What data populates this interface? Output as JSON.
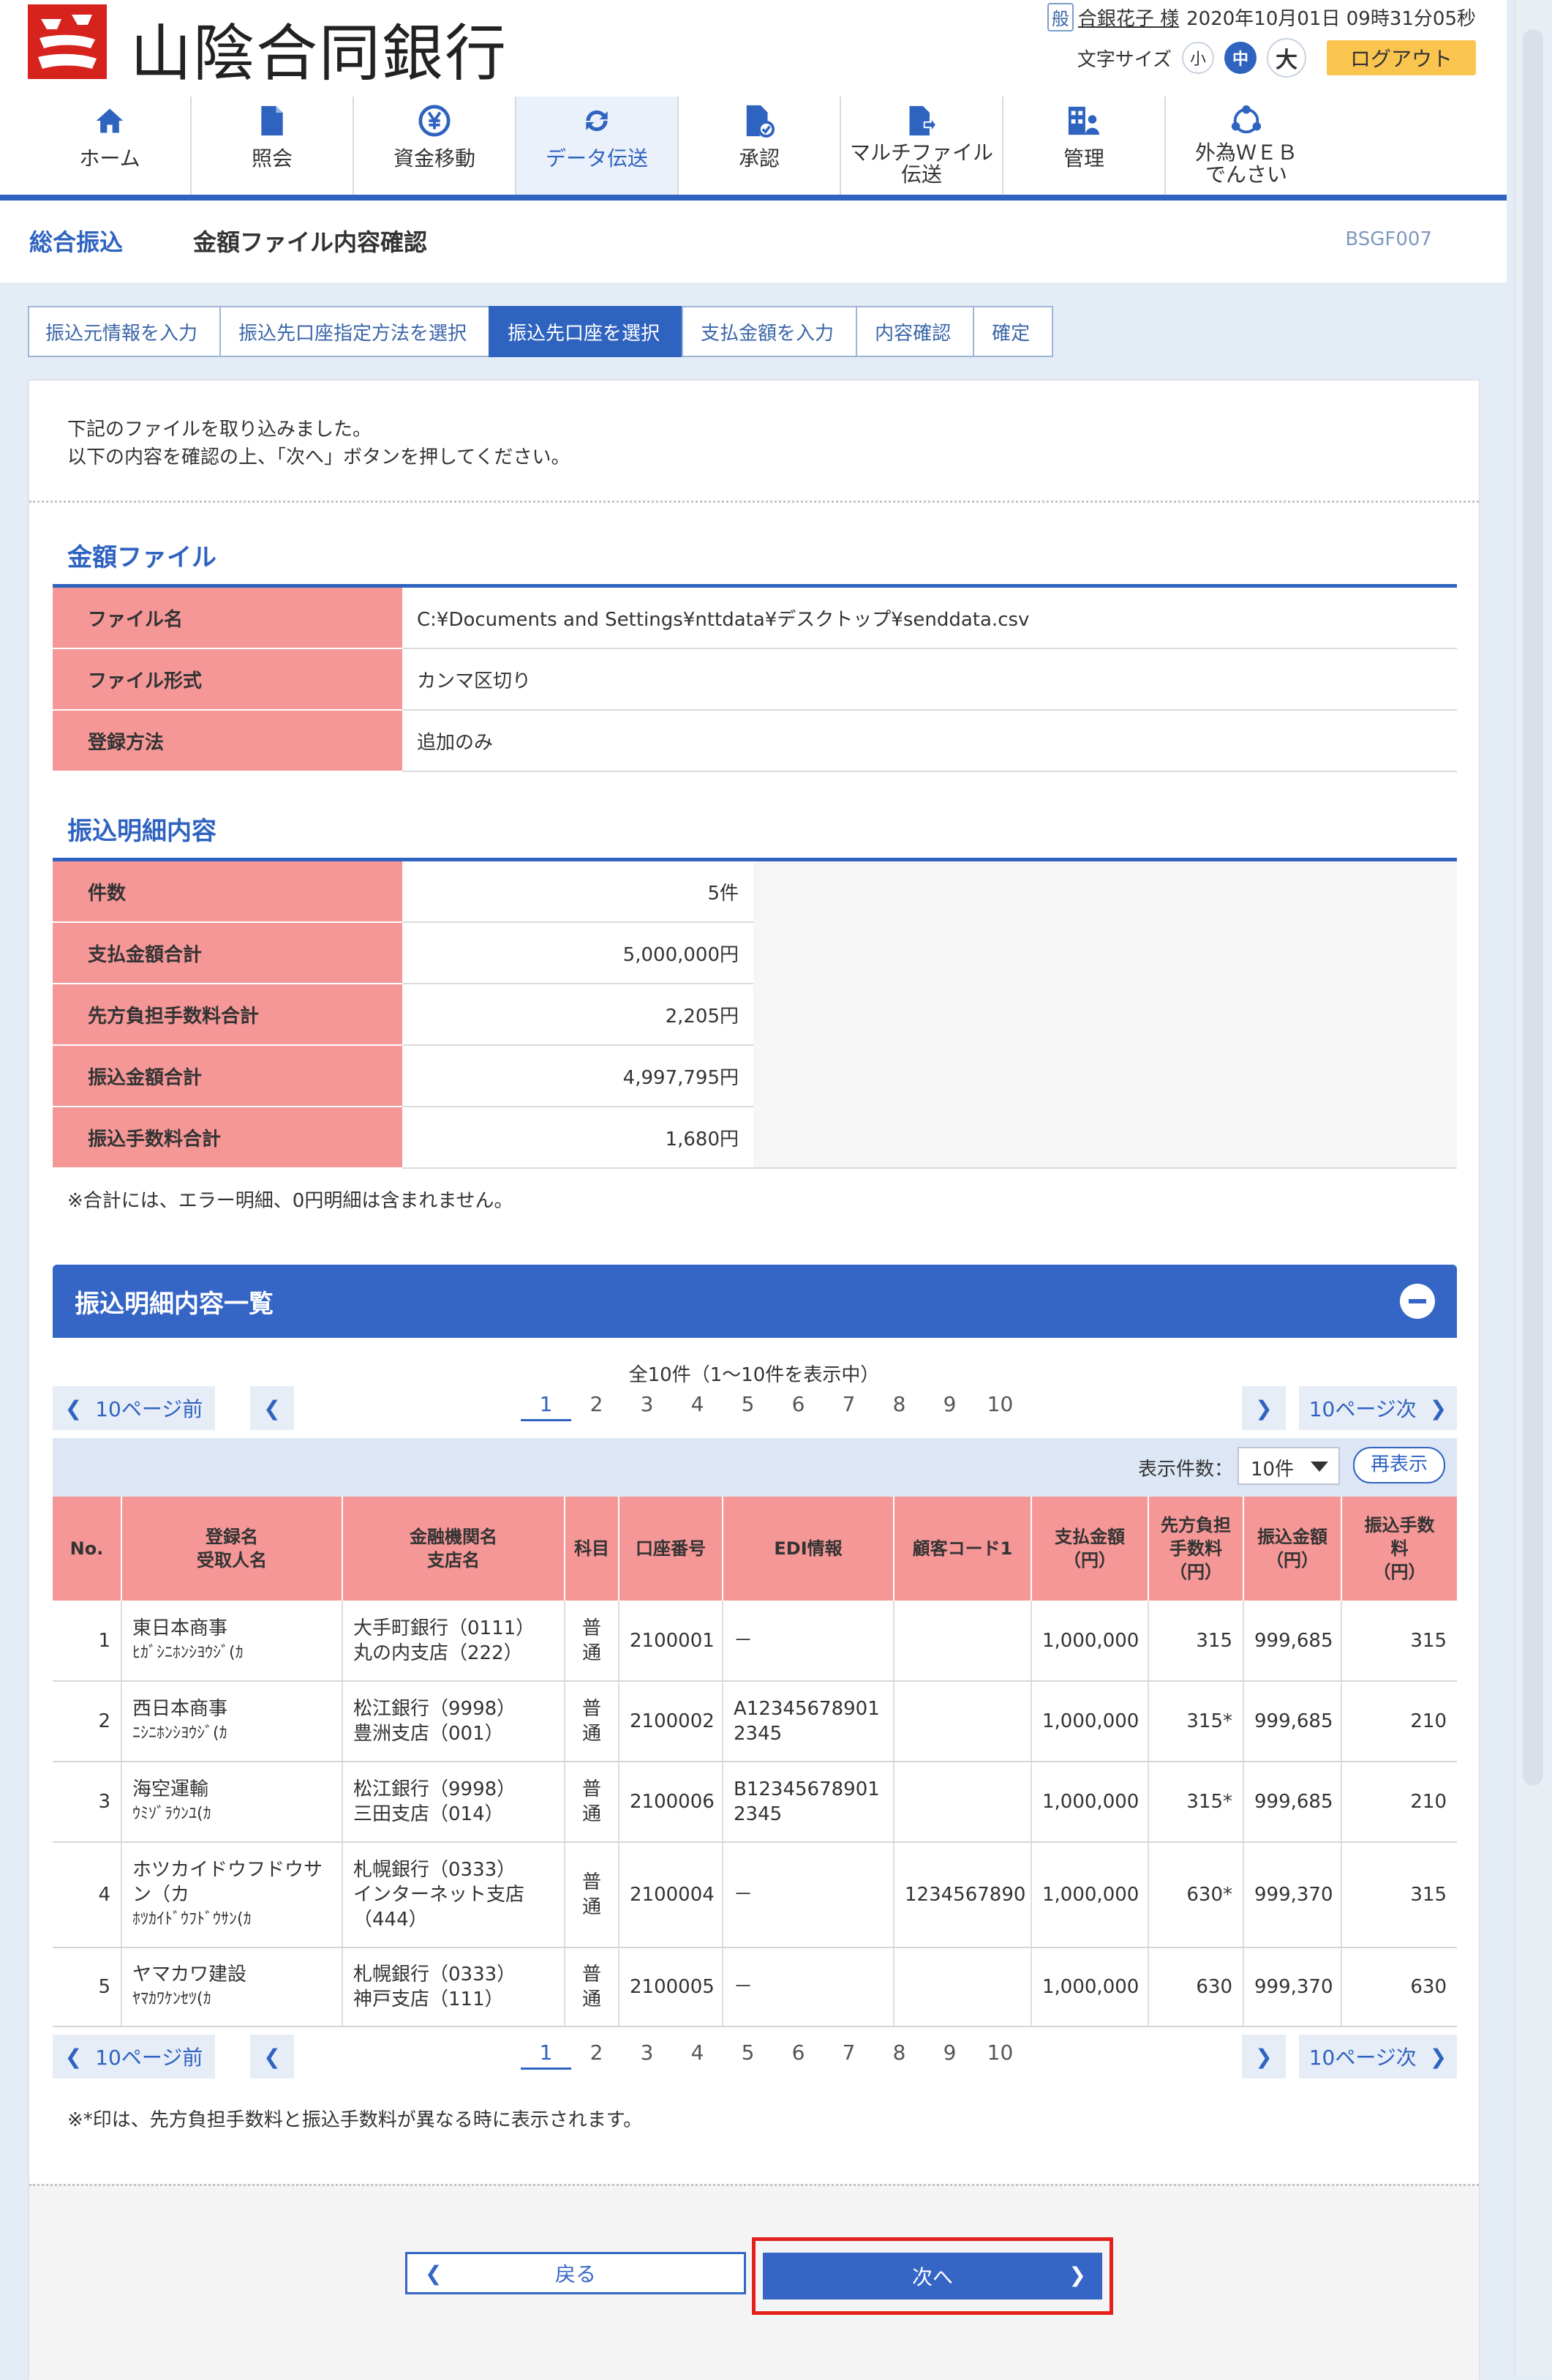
{
  "header": {
    "bank_name": "山陰合同銀行",
    "user_badge": "般",
    "user_name": "合銀花子 様",
    "datetime": "2020年10月01日 09時31分05秒",
    "font_size_label": "文字サイズ",
    "font_sizes": [
      "小",
      "中",
      "大"
    ],
    "logout": "ログアウト"
  },
  "nav": [
    {
      "label": "ホーム",
      "icon": "home-icon"
    },
    {
      "label": "照会",
      "icon": "document-icon"
    },
    {
      "label": "資金移動",
      "icon": "yen-icon"
    },
    {
      "label": "データ伝送",
      "icon": "refresh-icon"
    },
    {
      "label": "承認",
      "icon": "approve-icon"
    },
    {
      "label": "マルチファイル",
      "label2": "伝送",
      "icon": "file-send-icon"
    },
    {
      "label": "管理",
      "icon": "admin-icon"
    },
    {
      "label": "外為ＷＥＢ",
      "label2": "でんさい",
      "icon": "network-icon"
    }
  ],
  "page": {
    "category": "総合振込",
    "title": "金額ファイル内容確認",
    "code": "BSGF007"
  },
  "steps": [
    "振込元情報を入力",
    "振込先口座指定方法を選択",
    "振込先口座を選択",
    "支払金額を入力",
    "内容確認",
    "確定"
  ],
  "intro": {
    "line1": "下記のファイルを取り込みました。",
    "line2": "以下の内容を確認の上、「次へ」ボタンを押してください。"
  },
  "file_section": {
    "title": "金額ファイル",
    "rows": [
      {
        "label": "ファイル名",
        "value": "C:¥Documents and Settings¥nttdata¥デスクトップ¥senddata.csv"
      },
      {
        "label": "ファイル形式",
        "value": "カンマ区切り"
      },
      {
        "label": "登録方法",
        "value": "追加のみ"
      }
    ]
  },
  "summary_section": {
    "title": "振込明細内容",
    "rows": [
      {
        "label": "件数",
        "value": "5件"
      },
      {
        "label": "支払金額合計",
        "value": "5,000,000円"
      },
      {
        "label": "先方負担手数料合計",
        "value": "2,205円"
      },
      {
        "label": "振込金額合計",
        "value": "4,997,795円"
      },
      {
        "label": "振込手数料合計",
        "value": "1,680円"
      }
    ],
    "note": "※合計には、エラー明細、0円明細は含まれません。"
  },
  "list": {
    "title": "振込明細内容一覧",
    "count_text": "全10件（1～10件を表示中）",
    "prev10": "10ページ前",
    "next10": "10ページ次",
    "pages": [
      "1",
      "2",
      "3",
      "4",
      "5",
      "6",
      "7",
      "8",
      "9",
      "10"
    ],
    "per_page_label": "表示件数：",
    "per_page_value": "10件",
    "redisplay": "再表示",
    "headers": {
      "no": "No.",
      "name1": "登録名",
      "name2": "受取人名",
      "bank1": "金融機関名",
      "bank2": "支店名",
      "type": "科目",
      "account": "口座番号",
      "edi": "EDI情報",
      "customer": "顧客コード1",
      "pay1": "支払金額",
      "pay2": "（円）",
      "fee1": "先方負担",
      "fee2": "手数料",
      "fee3": "（円）",
      "amt1": "振込金額",
      "amt2": "（円）",
      "tf1": "振込手数",
      "tf2": "料",
      "tf3": "（円）"
    },
    "rows": [
      {
        "no": "1",
        "name": "東日本商事",
        "kana": "ﾋｶﾞｼﾆﾎﾝｼﾖｳｼﾞ(ｶ",
        "bank": "大手町銀行（0111）",
        "branch": "丸の内支店（222）",
        "type": "普通",
        "account": "2100001",
        "edi": "－",
        "customer": "",
        "pay": "1,000,000",
        "fee": "315",
        "amount": "999,685",
        "tfee": "315"
      },
      {
        "no": "2",
        "name": "西日本商事",
        "kana": "ﾆｼﾆﾎﾝｼﾖｳｼﾞ(ｶ",
        "bank": "松江銀行（9998）",
        "branch": "豊洲支店（001）",
        "type": "普通",
        "account": "2100002",
        "edi": "A12345678901 2345",
        "customer": "",
        "pay": "1,000,000",
        "fee": "315*",
        "amount": "999,685",
        "tfee": "210"
      },
      {
        "no": "3",
        "name": "海空運輸",
        "kana": "ｳﾐｿﾞﾗｳﾝﾕ(ｶ",
        "bank": "松江銀行（9998）",
        "branch": "三田支店（014）",
        "type": "普通",
        "account": "2100006",
        "edi": "B12345678901 2345",
        "customer": "",
        "pay": "1,000,000",
        "fee": "315*",
        "amount": "999,685",
        "tfee": "210"
      },
      {
        "no": "4",
        "name": "ホツカイドウフドウサン（カ",
        "kana": "ﾎﾂｶｲﾄﾞｳﾌﾄﾞｳｻﾝ(ｶ",
        "bank": "札幌銀行（0333）",
        "branch": "インターネット支店（444）",
        "type": "普通",
        "account": "2100004",
        "edi": "－",
        "customer": "1234567890",
        "pay": "1,000,000",
        "fee": "630*",
        "amount": "999,370",
        "tfee": "315"
      },
      {
        "no": "5",
        "name": "ヤマカワ建設",
        "kana": "ﾔﾏｶﾜｹﾝｾﾂ(ｶ",
        "bank": "札幌銀行（0333）",
        "branch": "神戸支店（111）",
        "type": "普通",
        "account": "2100005",
        "edi": "－",
        "customer": "",
        "pay": "1,000,000",
        "fee": "630",
        "amount": "999,370",
        "tfee": "630"
      }
    ],
    "note": "※*印は、先方負担手数料と振込手数料が異なる時に表示されます。"
  },
  "buttons": {
    "back": "戻る",
    "next": "次へ"
  },
  "colors": {
    "accent": "#2f63c0",
    "header_cell": "#f59797",
    "highlight": "#e3201c",
    "logout": "#f9c54f"
  }
}
